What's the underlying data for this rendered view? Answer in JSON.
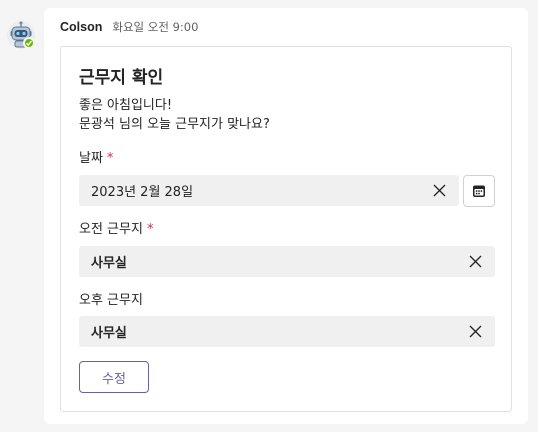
{
  "message": {
    "sender": "Colson",
    "timestamp": "화요일 오전 9:00",
    "avatar_icon": "robot-icon",
    "presence": "available"
  },
  "card": {
    "title": "근무지 확인",
    "greeting_line1": "좋은 아침입니다!",
    "greeting_line2": "문광석 님의 오늘 근무지가 맞나요?",
    "date": {
      "label": "날짜",
      "required_mark": "*",
      "value": "2023년 2월 28일",
      "picker_icon": "calendar-icon"
    },
    "morning": {
      "label": "오전 근무지",
      "required_mark": "*",
      "value": "사무실"
    },
    "afternoon": {
      "label": "오후 근무지",
      "value": "사무실"
    },
    "edit_button": "수정"
  },
  "colors": {
    "accent": "#6264a7",
    "required": "#c4314b",
    "presence": "#6bb700",
    "field_bg": "#f0f0f0",
    "page_bg": "#f5f5f5"
  }
}
